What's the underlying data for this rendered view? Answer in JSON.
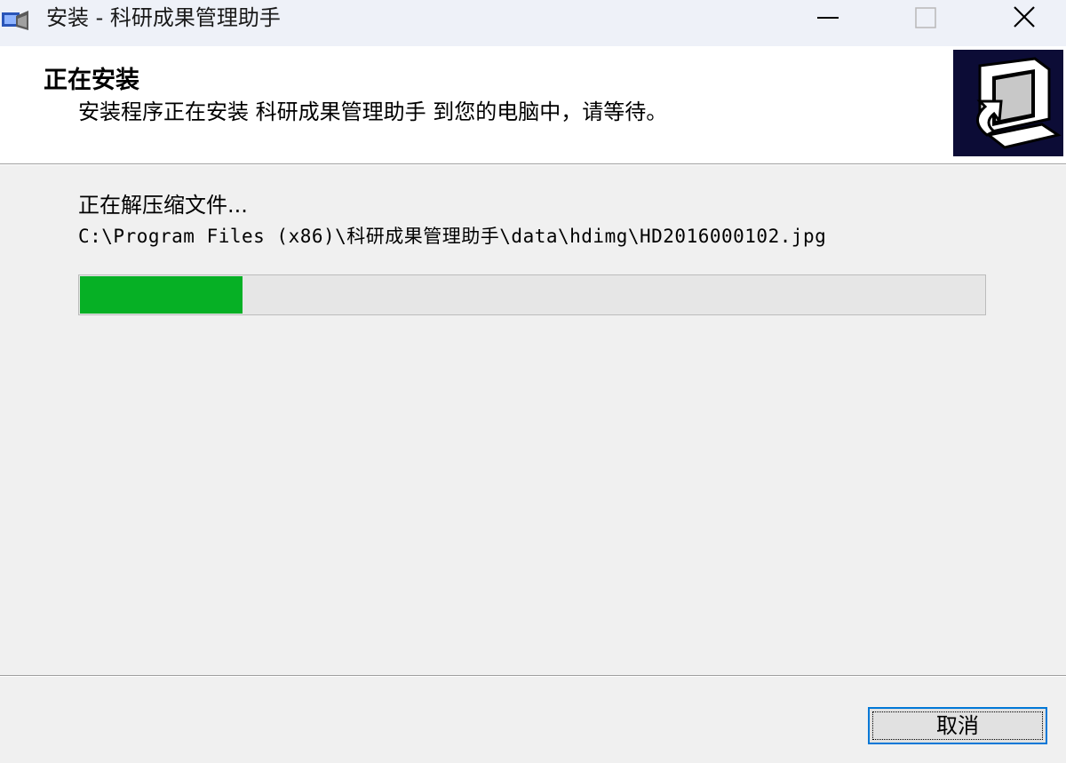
{
  "window": {
    "title": "安装 - 科研成果管理助手",
    "icon": "installer-icon",
    "controls": [
      "minimize-icon",
      "maximize-icon",
      "close-icon"
    ]
  },
  "header": {
    "title": "正在安装",
    "subtitle": "安装程序正在安装 科研成果管理助手 到您的电脑中，请等待。",
    "image": "computer-install-icon"
  },
  "main": {
    "status": "正在解压缩文件...",
    "current_file": "C:\\Program Files (x86)\\科研成果管理助手\\data\\hdimg\\HD2016000102.jpg",
    "progress_fraction": 0.18,
    "progress_color": "#06b025"
  },
  "footer": {
    "cancel_label": "取消"
  },
  "colors": {
    "titlebar_bg": "#eef1f8",
    "header_bg": "#ffffff",
    "body_bg": "#f0f0f0",
    "header_image_bg": "#0c0c36",
    "focus_border": "#0078d7"
  }
}
